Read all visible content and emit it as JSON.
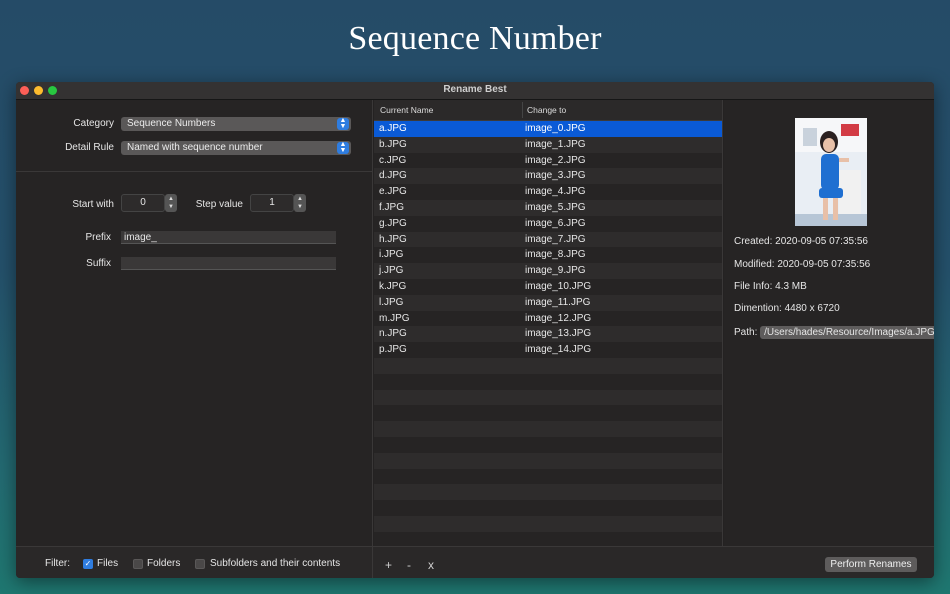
{
  "banner": {
    "title": "Sequence Number"
  },
  "window": {
    "title": "Rename Best"
  },
  "settings": {
    "category_label": "Category",
    "category_value": "Sequence Numbers",
    "detail_rule_label": "Detail Rule",
    "detail_rule_value": "Named with sequence number",
    "start_with_label": "Start with",
    "start_with_value": "0",
    "step_value_label": "Step value",
    "step_value_value": "1",
    "prefix_label": "Prefix",
    "prefix_value": "image_",
    "suffix_label": "Suffix",
    "suffix_value": ""
  },
  "table": {
    "col_current": "Current Name",
    "col_change": "Change to",
    "rows": [
      {
        "current": "a.JPG",
        "change": "image_0.JPG"
      },
      {
        "current": "b.JPG",
        "change": "image_1.JPG"
      },
      {
        "current": "c.JPG",
        "change": "image_2.JPG"
      },
      {
        "current": "d.JPG",
        "change": "image_3.JPG"
      },
      {
        "current": "e.JPG",
        "change": "image_4.JPG"
      },
      {
        "current": "f.JPG",
        "change": "image_5.JPG"
      },
      {
        "current": "g.JPG",
        "change": "image_6.JPG"
      },
      {
        "current": "h.JPG",
        "change": "image_7.JPG"
      },
      {
        "current": "i.JPG",
        "change": "image_8.JPG"
      },
      {
        "current": "j.JPG",
        "change": "image_9.JPG"
      },
      {
        "current": "k.JPG",
        "change": "image_10.JPG"
      },
      {
        "current": "l.JPG",
        "change": "image_11.JPG"
      },
      {
        "current": "m.JPG",
        "change": "image_12.JPG"
      },
      {
        "current": "n.JPG",
        "change": "image_13.JPG"
      },
      {
        "current": "p.JPG",
        "change": "image_14.JPG"
      }
    ]
  },
  "file_info": {
    "created": "Created: 2020-09-05 07:35:56",
    "modified": "Modified: 2020-09-05 07:35:56",
    "file_info": "File Info: 4.3 MB",
    "dimension": "Dimention: 4480 x 6720",
    "path_label": "Path:",
    "path_value": "/Users/hades/Resource/Images/a.JPG"
  },
  "filter": {
    "label": "Filter:",
    "files": "Files",
    "folders": "Folders",
    "subfolders": "Subfolders and their contents"
  },
  "actions": {
    "add": "+",
    "remove": "-",
    "clear": "x",
    "perform": "Perform Renames"
  },
  "colors": {
    "selection": "#0a5ad6",
    "accent": "#2f7de0"
  }
}
